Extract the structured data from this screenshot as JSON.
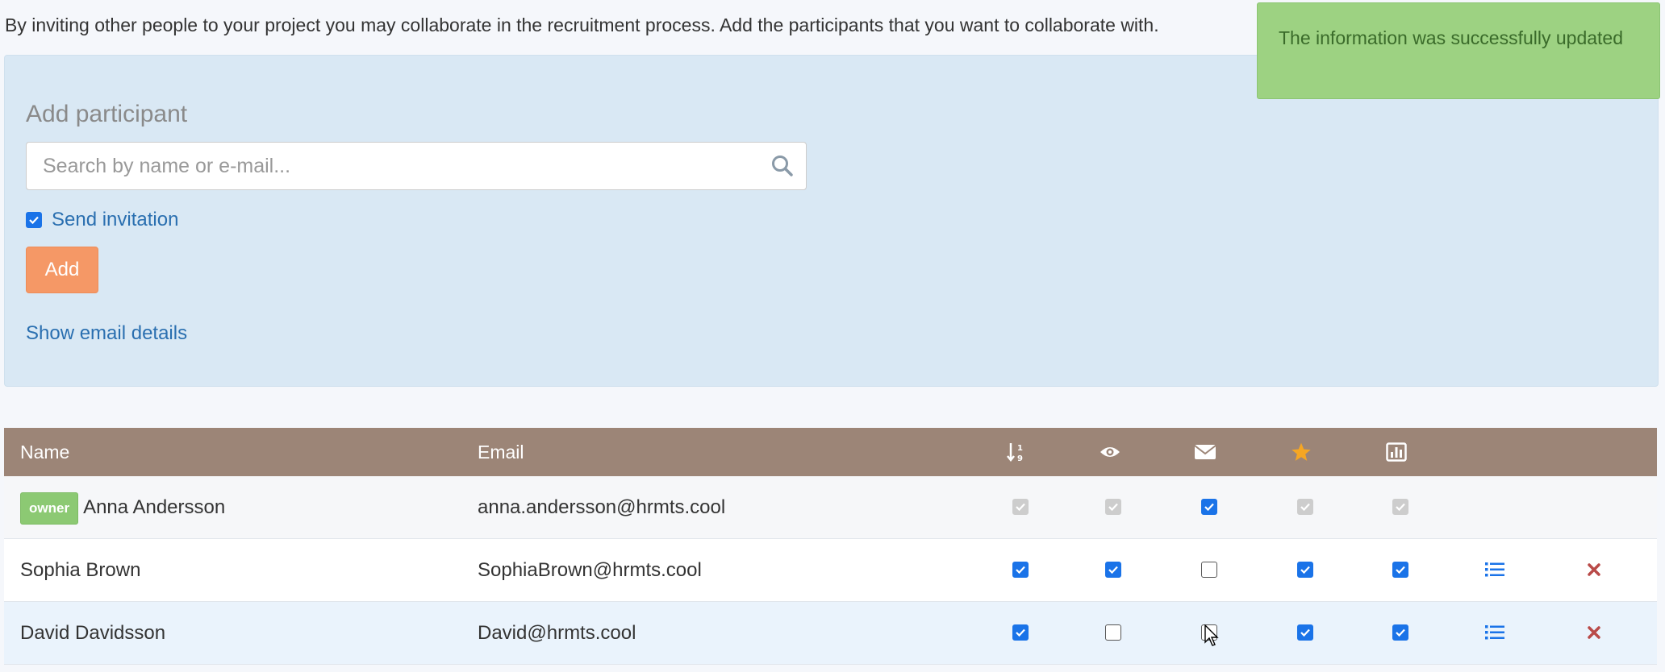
{
  "intro": "By inviting other people to your project you may collaborate in the recruitment process. Add the participants that you want to collaborate with.",
  "toast": {
    "message": "The information was successfully updated",
    "color": "#9dd282"
  },
  "add_participant": {
    "title": "Add participant",
    "search": {
      "placeholder": "Search by name or e-mail...",
      "value": ""
    },
    "send_invitation": {
      "label": "Send invitation",
      "checked": true
    },
    "add_button": "Add",
    "show_email_details": "Show email details"
  },
  "table": {
    "columns": {
      "name": "Name",
      "email": "Email",
      "icons": [
        "sort-numeric-icon",
        "eye-icon",
        "envelope-icon",
        "star-icon",
        "bar-chart-icon"
      ]
    },
    "rows": [
      {
        "badge": "owner",
        "name": "Anna Andersson",
        "email": "anna.andersson@hrmts.cool",
        "permissions": [
          "disabled-checked",
          "disabled-checked",
          "checked",
          "disabled-checked",
          "disabled-checked"
        ],
        "actions": false
      },
      {
        "badge": "",
        "name": "Sophia Brown",
        "email": "SophiaBrown@hrmts.cool",
        "permissions": [
          "checked",
          "checked",
          "unchecked",
          "checked",
          "checked"
        ],
        "actions": true
      },
      {
        "badge": "",
        "name": "David Davidsson",
        "email": "David@hrmts.cool",
        "permissions": [
          "checked",
          "unchecked",
          "unchecked",
          "checked",
          "checked"
        ],
        "actions": true
      }
    ]
  },
  "colors": {
    "panel": "#d9e8f4",
    "table_header": "#9c8577",
    "accent_button": "#f59866",
    "link": "#2a6fb0",
    "checkbox": "#1a73e8",
    "star": "#f5a623",
    "remove": "#b94a48"
  }
}
